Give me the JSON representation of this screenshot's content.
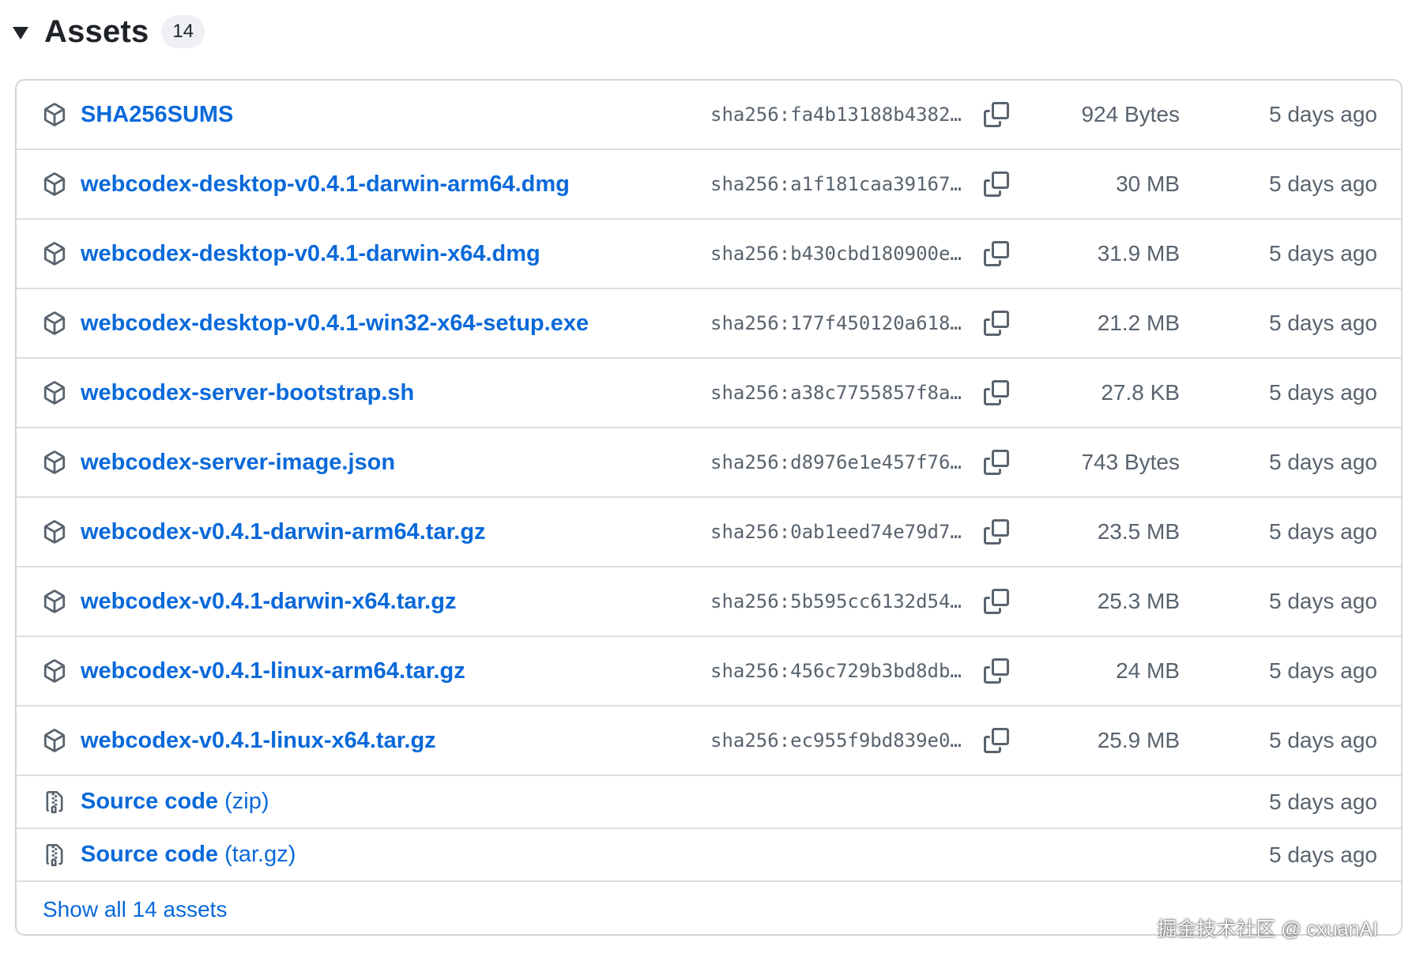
{
  "section": {
    "title": "Assets",
    "count": "14"
  },
  "assets": [
    {
      "name": "SHA256SUMS",
      "sha": "sha256:fa4b13188b4382…",
      "size": "924 Bytes",
      "date": "5 days ago"
    },
    {
      "name": "webcodex-desktop-v0.4.1-darwin-arm64.dmg",
      "sha": "sha256:a1f181caa39167…",
      "size": "30 MB",
      "date": "5 days ago"
    },
    {
      "name": "webcodex-desktop-v0.4.1-darwin-x64.dmg",
      "sha": "sha256:b430cbd180900e…",
      "size": "31.9 MB",
      "date": "5 days ago"
    },
    {
      "name": "webcodex-desktop-v0.4.1-win32-x64-setup.exe",
      "sha": "sha256:177f450120a618…",
      "size": "21.2 MB",
      "date": "5 days ago"
    },
    {
      "name": "webcodex-server-bootstrap.sh",
      "sha": "sha256:a38c7755857f8a…",
      "size": "27.8 KB",
      "date": "5 days ago"
    },
    {
      "name": "webcodex-server-image.json",
      "sha": "sha256:d8976e1e457f76…",
      "size": "743 Bytes",
      "date": "5 days ago"
    },
    {
      "name": "webcodex-v0.4.1-darwin-arm64.tar.gz",
      "sha": "sha256:0ab1eed74e79d7…",
      "size": "23.5 MB",
      "date": "5 days ago"
    },
    {
      "name": "webcodex-v0.4.1-darwin-x64.tar.gz",
      "sha": "sha256:5b595cc6132d54…",
      "size": "25.3 MB",
      "date": "5 days ago"
    },
    {
      "name": "webcodex-v0.4.1-linux-arm64.tar.gz",
      "sha": "sha256:456c729b3bd8db…",
      "size": "24 MB",
      "date": "5 days ago"
    },
    {
      "name": "webcodex-v0.4.1-linux-x64.tar.gz",
      "sha": "sha256:ec955f9bd839e0…",
      "size": "25.9 MB",
      "date": "5 days ago"
    }
  ],
  "sources": [
    {
      "label": "Source code",
      "suffix": "(zip)",
      "date": "5 days ago"
    },
    {
      "label": "Source code",
      "suffix": "(tar.gz)",
      "date": "5 days ago"
    }
  ],
  "footer": {
    "show_all": "Show all 14 assets"
  },
  "watermark": "掘金技术社区 @ cxuanAI",
  "icons": {
    "asset": "package-icon",
    "copy": "copy-icon",
    "source": "file-zip-icon",
    "toggle": "triangle-down-icon"
  },
  "colors": {
    "link": "#0969da",
    "muted": "#59636e",
    "border": "#d0d7de"
  }
}
